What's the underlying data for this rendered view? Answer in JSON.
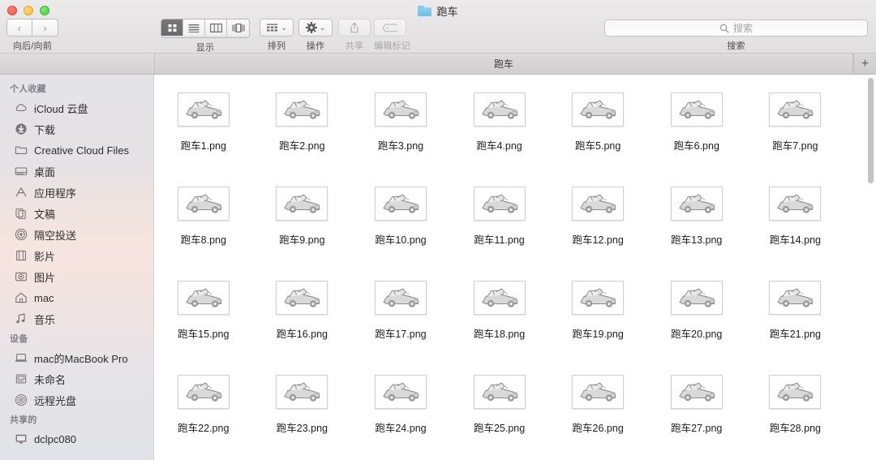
{
  "window": {
    "title": "跑车",
    "folder_icon": "folder-icon",
    "traffic_lights": [
      "close",
      "minimize",
      "zoom"
    ]
  },
  "toolbar": {
    "nav": {
      "back_glyph": "‹",
      "forward_glyph": "›",
      "caption": "向后/向前"
    },
    "view": {
      "caption": "显示",
      "modes": [
        {
          "name": "icon-view",
          "selected": true
        },
        {
          "name": "list-view",
          "selected": false
        },
        {
          "name": "column-view",
          "selected": false
        },
        {
          "name": "gallery-view",
          "selected": false
        }
      ]
    },
    "arrange": {
      "caption": "排列",
      "icon": "grid-icon",
      "chevron": "⌄"
    },
    "action": {
      "caption": "操作",
      "icon": "gear-icon",
      "chevron": "⌄"
    },
    "share": {
      "caption": "共享",
      "icon": "share-icon",
      "enabled": false
    },
    "tags": {
      "caption": "编辑标记",
      "icon": "tag-icon",
      "enabled": false
    },
    "search": {
      "caption": "搜索",
      "placeholder": "搜索",
      "value": "",
      "icon": "search-icon"
    }
  },
  "tabbar": {
    "active_tab": "跑车",
    "new_tab_glyph": "+"
  },
  "sidebar": {
    "sections": [
      {
        "header": "个人收藏",
        "items": [
          {
            "label": "iCloud 云盘",
            "icon": "cloud-icon"
          },
          {
            "label": "下载",
            "icon": "download-icon"
          },
          {
            "label": "Creative Cloud Files",
            "icon": "folder-icon"
          },
          {
            "label": "桌面",
            "icon": "desktop-icon"
          },
          {
            "label": "应用程序",
            "icon": "applications-icon"
          },
          {
            "label": "文稿",
            "icon": "documents-icon"
          },
          {
            "label": "隔空投送",
            "icon": "airdrop-icon"
          },
          {
            "label": "影片",
            "icon": "movies-icon"
          },
          {
            "label": "图片",
            "icon": "pictures-icon"
          },
          {
            "label": "mac",
            "icon": "home-icon"
          },
          {
            "label": "音乐",
            "icon": "music-icon"
          }
        ]
      },
      {
        "header": "设备",
        "items": [
          {
            "label": "mac的MacBook Pro",
            "icon": "laptop-icon"
          },
          {
            "label": "未命名",
            "icon": "harddisk-icon"
          },
          {
            "label": "远程光盘",
            "icon": "disc-icon"
          }
        ]
      },
      {
        "header": "共享的",
        "items": [
          {
            "label": "dclpc080",
            "icon": "display-icon"
          }
        ]
      }
    ]
  },
  "content": {
    "view_mode": "icon",
    "files": [
      {
        "name": "跑车1.png",
        "kind": "png-image",
        "thumbnail": "sports-car-sketch"
      },
      {
        "name": "跑车2.png",
        "kind": "png-image",
        "thumbnail": "sports-car-sketch"
      },
      {
        "name": "跑车3.png",
        "kind": "png-image",
        "thumbnail": "sports-car-sketch"
      },
      {
        "name": "跑车4.png",
        "kind": "png-image",
        "thumbnail": "sports-car-sketch"
      },
      {
        "name": "跑车5.png",
        "kind": "png-image",
        "thumbnail": "sports-car-sketch"
      },
      {
        "name": "跑车6.png",
        "kind": "png-image",
        "thumbnail": "sports-car-sketch"
      },
      {
        "name": "跑车7.png",
        "kind": "png-image",
        "thumbnail": "sports-car-sketch"
      },
      {
        "name": "跑车8.png",
        "kind": "png-image",
        "thumbnail": "sports-car-sketch"
      },
      {
        "name": "跑车9.png",
        "kind": "png-image",
        "thumbnail": "sports-car-sketch"
      },
      {
        "name": "跑车10.png",
        "kind": "png-image",
        "thumbnail": "sports-car-sketch"
      },
      {
        "name": "跑车11.png",
        "kind": "png-image",
        "thumbnail": "sports-car-sketch"
      },
      {
        "name": "跑车12.png",
        "kind": "png-image",
        "thumbnail": "sports-car-sketch"
      },
      {
        "name": "跑车13.png",
        "kind": "png-image",
        "thumbnail": "sports-car-sketch"
      },
      {
        "name": "跑车14.png",
        "kind": "png-image",
        "thumbnail": "sports-car-sketch"
      },
      {
        "name": "跑车15.png",
        "kind": "png-image",
        "thumbnail": "sports-car-sketch"
      },
      {
        "name": "跑车16.png",
        "kind": "png-image",
        "thumbnail": "sports-car-sketch"
      },
      {
        "name": "跑车17.png",
        "kind": "png-image",
        "thumbnail": "sports-car-sketch"
      },
      {
        "name": "跑车18.png",
        "kind": "png-image",
        "thumbnail": "sports-car-sketch"
      },
      {
        "name": "跑车19.png",
        "kind": "png-image",
        "thumbnail": "sports-car-sketch"
      },
      {
        "name": "跑车20.png",
        "kind": "png-image",
        "thumbnail": "sports-car-sketch"
      },
      {
        "name": "跑车21.png",
        "kind": "png-image",
        "thumbnail": "sports-car-sketch"
      },
      {
        "name": "跑车22.png",
        "kind": "png-image",
        "thumbnail": "sports-car-sketch"
      },
      {
        "name": "跑车23.png",
        "kind": "png-image",
        "thumbnail": "sports-car-sketch"
      },
      {
        "name": "跑车24.png",
        "kind": "png-image",
        "thumbnail": "sports-car-sketch"
      },
      {
        "name": "跑车25.png",
        "kind": "png-image",
        "thumbnail": "sports-car-sketch"
      },
      {
        "name": "跑车26.png",
        "kind": "png-image",
        "thumbnail": "sports-car-sketch"
      },
      {
        "name": "跑车27.png",
        "kind": "png-image",
        "thumbnail": "sports-car-sketch"
      },
      {
        "name": "跑车28.png",
        "kind": "png-image",
        "thumbnail": "sports-car-sketch"
      }
    ]
  },
  "colors": {
    "toolbar_bg": "#e8e6e6",
    "sidebar_tint": "#f3e3df",
    "accent_folder": "#6dbde6",
    "selected_view_btn": "#6f6f71",
    "text_primary": "#1d1d1d",
    "text_secondary": "#80808a"
  }
}
